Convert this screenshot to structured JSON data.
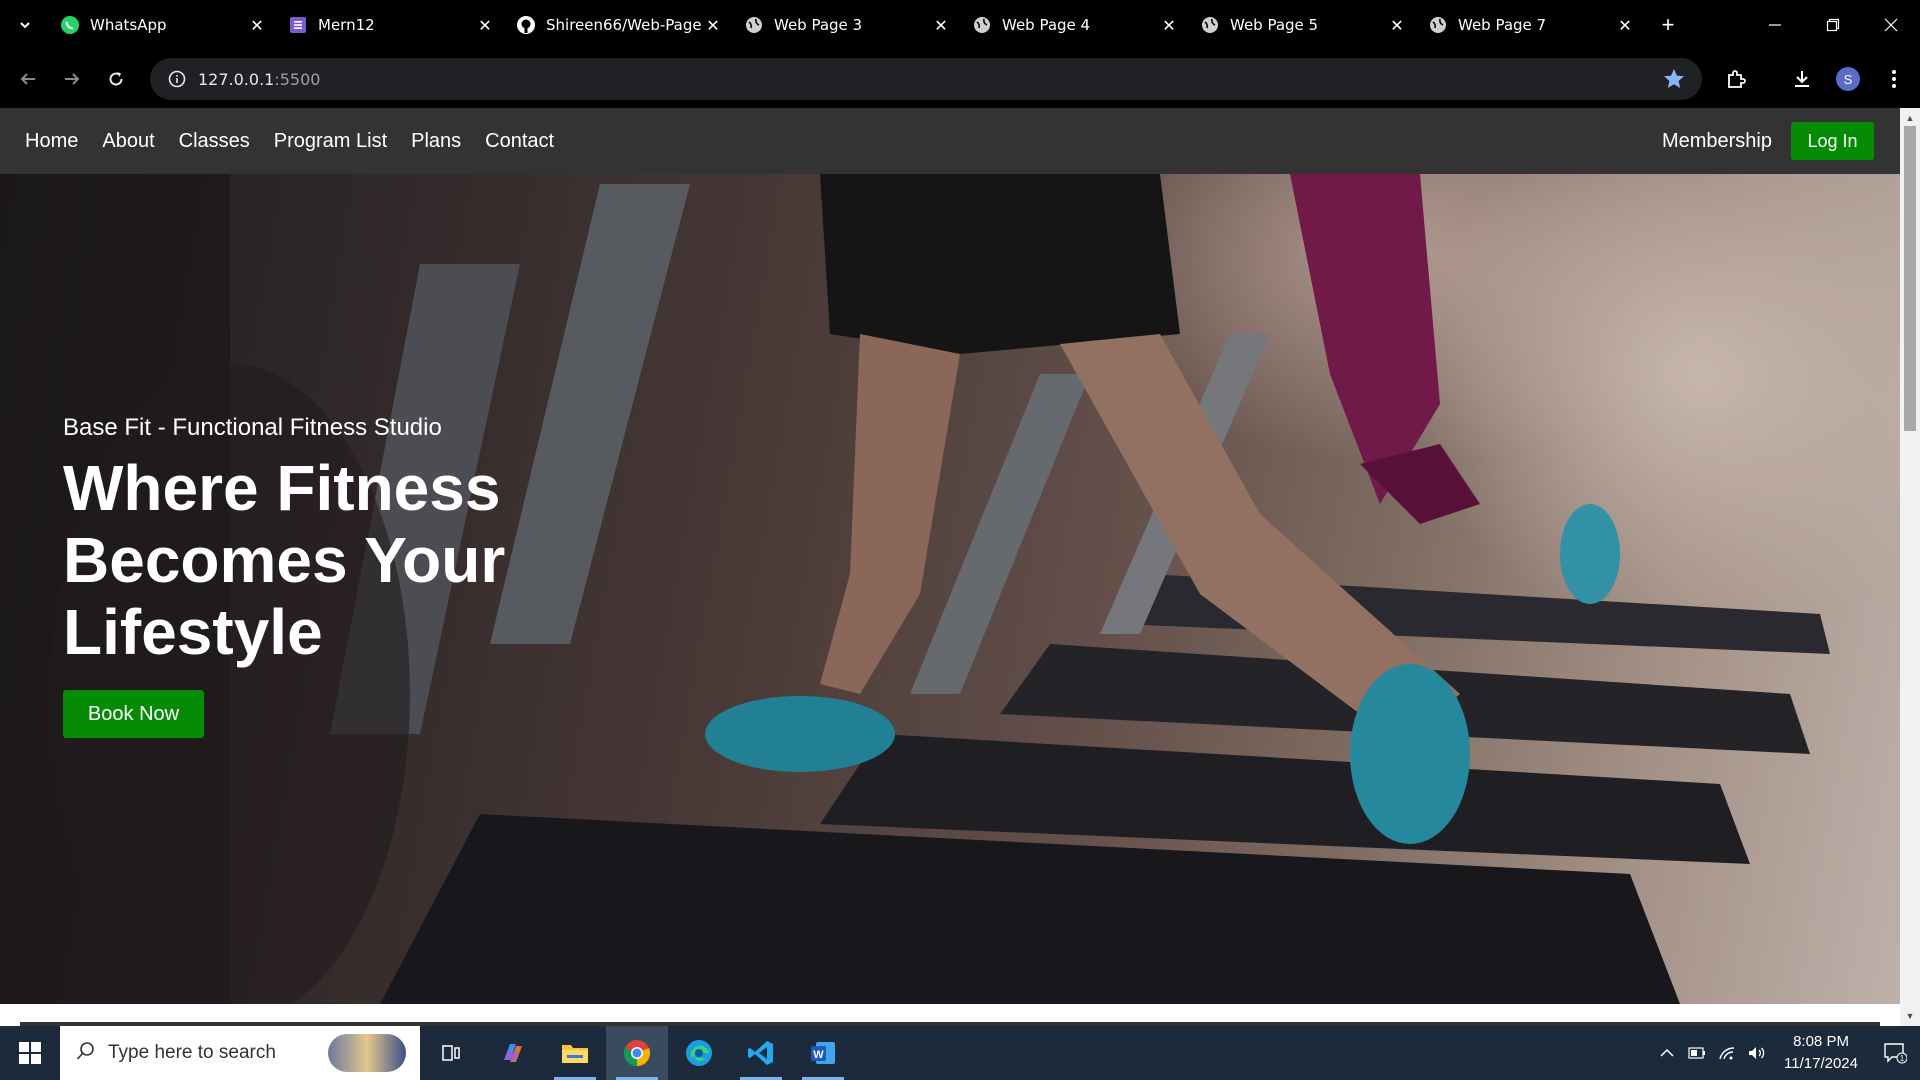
{
  "browser": {
    "tabs": [
      {
        "title": "WhatsApp",
        "icon": "whatsapp-icon",
        "color": "#25d366"
      },
      {
        "title": "Mern12",
        "icon": "forms-icon",
        "color": "#7b5cd6"
      },
      {
        "title": "Shireen66/Web-Page",
        "icon": "github-icon",
        "color": "#ffffff"
      },
      {
        "title": "Web Page 3",
        "icon": "globe-icon",
        "color": "#cfcfcf"
      },
      {
        "title": "Web Page 4",
        "icon": "globe-icon",
        "color": "#cfcfcf"
      },
      {
        "title": "Web Page 5",
        "icon": "globe-icon",
        "color": "#cfcfcf"
      },
      {
        "title": "Web Page 7",
        "icon": "globe-icon",
        "color": "#cfcfcf"
      }
    ],
    "close_glyph": "✕",
    "new_tab_glyph": "+",
    "url_host": "127.0.0.1",
    "url_port": ":5500",
    "profile_initial": "S"
  },
  "site": {
    "nav": [
      "Home",
      "About",
      "Classes",
      "Program List",
      "Plans",
      "Contact"
    ],
    "membership": "Membership",
    "login": "Log In",
    "accent": "#058b05"
  },
  "hero": {
    "subtitle": "Base Fit - Functional Fitness Studio",
    "title": "Where Fitness Becomes Your Lifestyle",
    "cta": "Book Now"
  },
  "taskbar": {
    "search_placeholder": "Type here to search",
    "time": "8:08 PM",
    "date": "11/17/2024",
    "notification_count": "1"
  }
}
